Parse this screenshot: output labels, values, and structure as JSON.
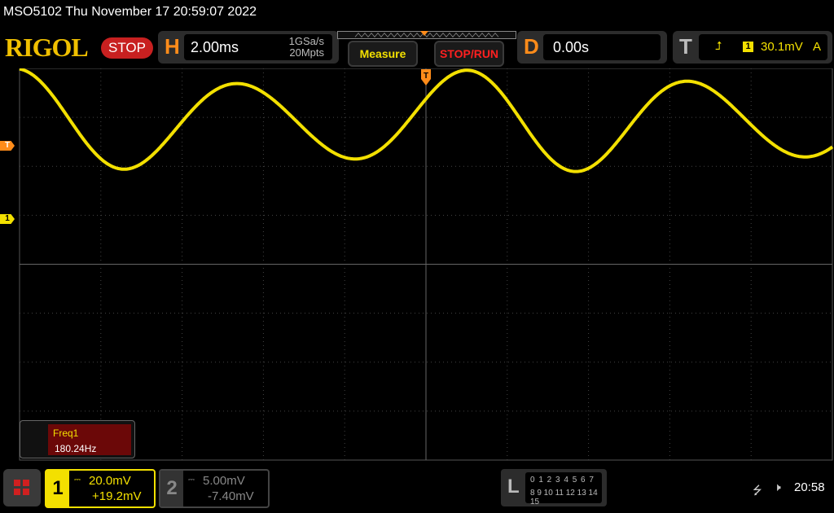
{
  "title_bar": {
    "text": "MSO5102  Thu November 17 20:59:07 2022"
  },
  "logo": {
    "text": "RIGOL"
  },
  "run_state": "STOP",
  "horizontal": {
    "letter": "H",
    "timebase": "2.00ms",
    "sample_rate": "1GSa/s",
    "memory_depth": "20Mpts"
  },
  "buttons": {
    "measure": "Measure",
    "stop_run": "STOP/RUN"
  },
  "delay": {
    "letter": "D",
    "value": "0.00s"
  },
  "trigger": {
    "letter": "T",
    "edge_icon": "rising-edge-icon",
    "edge_glyph": "⮥",
    "source": "1",
    "level": "30.1mV",
    "mode": "A"
  },
  "markers": {
    "trigger_level": "T",
    "channel1": "1",
    "trigger_position": "T"
  },
  "measurement": {
    "label": "Freq1",
    "value": "180.24Hz"
  },
  "channel1": {
    "number": "1",
    "coupling_glyph": "⎓",
    "scale": "20.0mV",
    "offset": "+19.2mV",
    "color": "#f3e000"
  },
  "channel2": {
    "number": "2",
    "coupling_glyph": "⎓",
    "scale": "5.00mV",
    "offset": "-7.40mV",
    "color": "#888888"
  },
  "logic_analyzer": {
    "letter": "L",
    "row1": "0 1 2 3  4 5 6 7",
    "row2": "8 9 10 11 12 13 14 15"
  },
  "status": {
    "usb_icon": "usb-icon",
    "speaker_icon": "speaker-muted-icon",
    "clock": "20:58"
  },
  "waveform": {
    "channel": "1",
    "frequency_hz": 180.24,
    "timebase_s_per_div": 0.002,
    "volts_per_div": 0.02,
    "trigger_level_v": 0.0301,
    "channel_offset_v": 0.0192
  }
}
